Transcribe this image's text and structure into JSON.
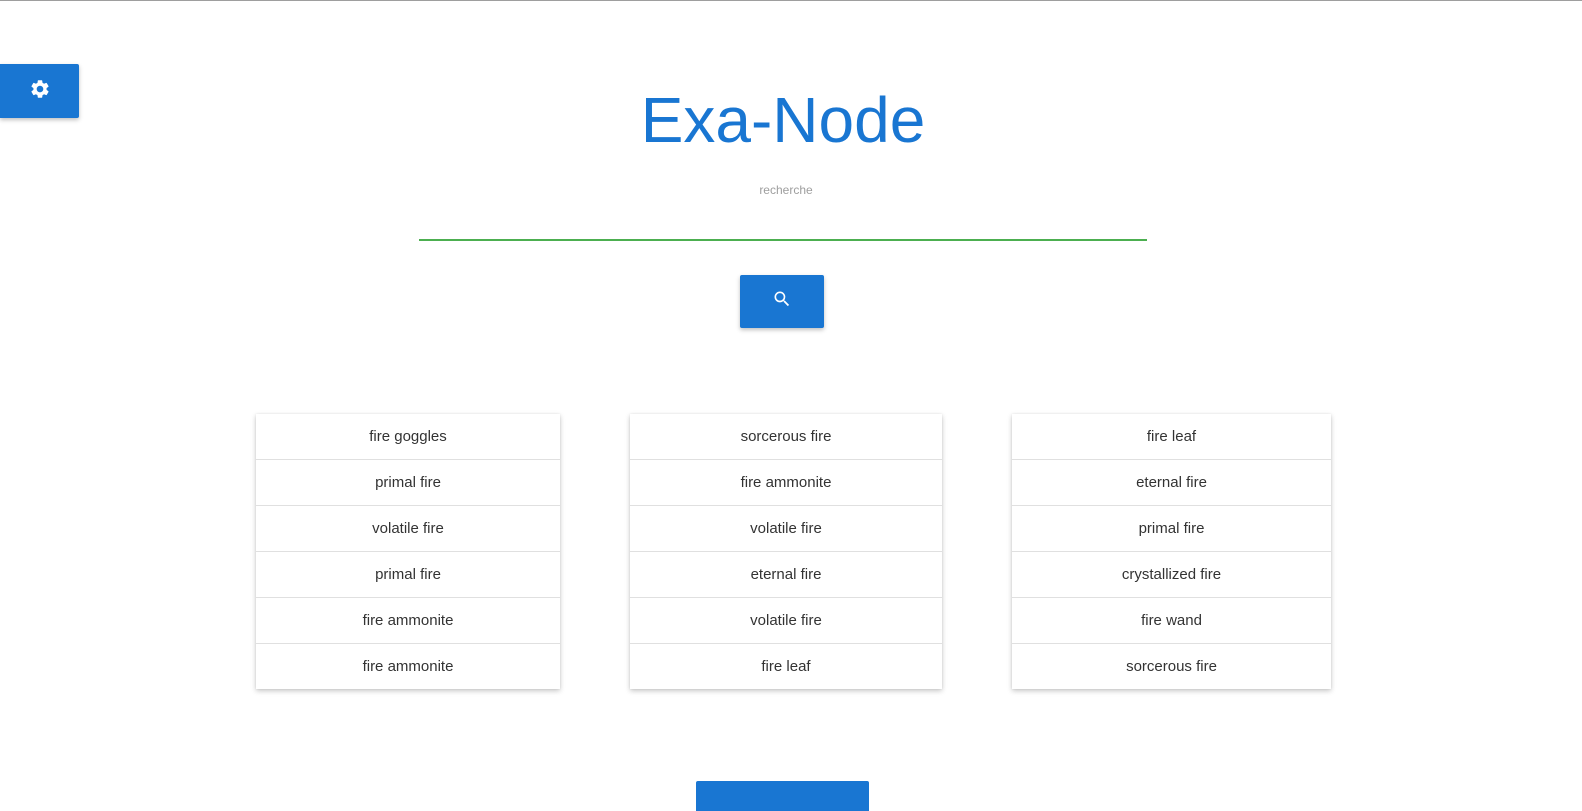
{
  "app": {
    "title": "Exa-Node"
  },
  "settings": {
    "icon": "gear-icon"
  },
  "search": {
    "label": "recherche",
    "value": "",
    "button_icon": "search-icon"
  },
  "colors": {
    "primary": "#1976d2",
    "input_underline": "#4caf50"
  },
  "results": {
    "columns": [
      {
        "items": [
          "fire goggles",
          "primal fire",
          "volatile fire",
          "primal fire",
          "fire ammonite",
          "fire ammonite"
        ]
      },
      {
        "items": [
          "sorcerous fire",
          "fire ammonite",
          "volatile fire",
          "eternal fire",
          "volatile fire",
          "fire leaf"
        ]
      },
      {
        "items": [
          "fire leaf",
          "eternal fire",
          "primal fire",
          "crystallized fire",
          "fire wand",
          "sorcerous fire"
        ]
      }
    ]
  }
}
